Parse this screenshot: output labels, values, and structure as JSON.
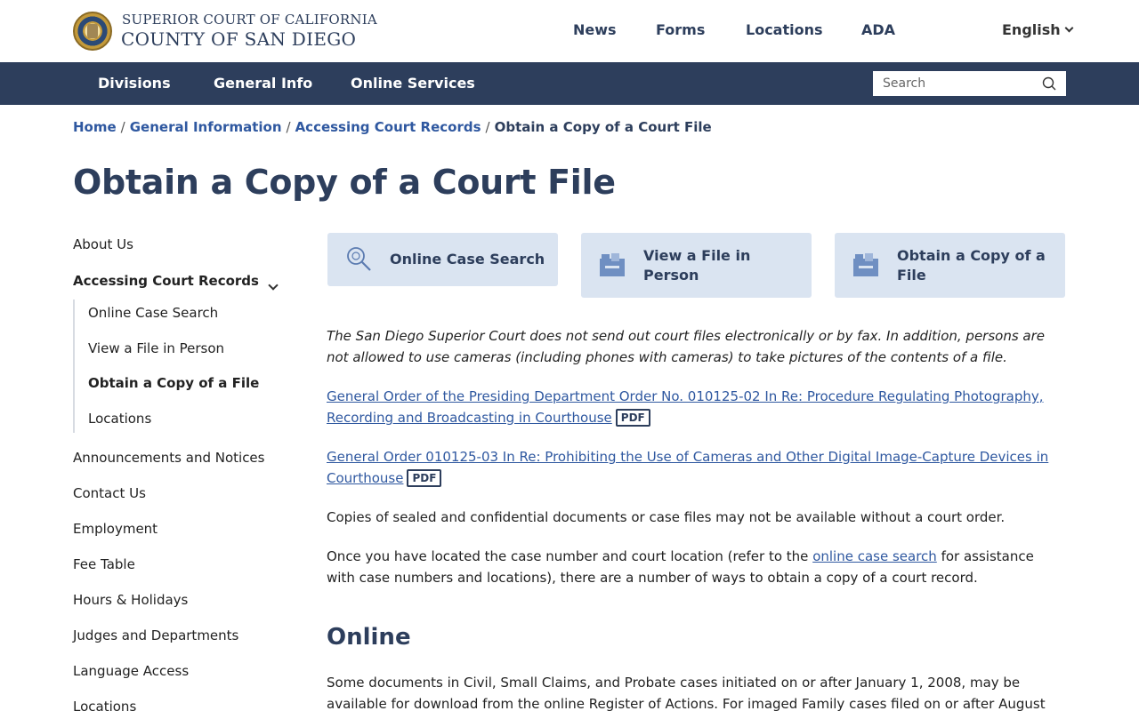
{
  "header": {
    "seal_icon": "court-seal-icon",
    "brand_top": "SUPERIOR COURT OF CALIFORNIA",
    "brand_main": "COUNTY OF SAN DIEGO",
    "links": [
      "News",
      "Forms",
      "Locations",
      "ADA"
    ],
    "language": "English"
  },
  "nav": {
    "items": [
      "Divisions",
      "General Info",
      "Online Services"
    ],
    "search_placeholder": "Search"
  },
  "breadcrumb": {
    "items": [
      "Home",
      "General Information",
      "Accessing Court Records"
    ],
    "separator": "/",
    "current": "Obtain a Copy of a Court File"
  },
  "page_title": "Obtain a Copy of a Court File",
  "sidebar": {
    "about": "About Us",
    "accessing": "Accessing Court Records",
    "sub_items": [
      "Online Case Search",
      "View a File in Person",
      "Obtain a Copy of a File",
      "Locations"
    ],
    "active_sub": "Obtain a Copy of a File",
    "items": [
      "Announcements and Notices",
      "Contact Us",
      "Employment",
      "Fee Table",
      "Hours & Holidays",
      "Judges and Departments",
      "Language Access",
      "Locations"
    ]
  },
  "cards": [
    {
      "label_1": "Online Case Search",
      "label_2": "",
      "icon": "magnifier-icon"
    },
    {
      "label_1": "View a File in",
      "label_2": "Person",
      "icon": "file-box-icon"
    },
    {
      "label_1": "Obtain a Copy of a",
      "label_2": "File",
      "icon": "file-box-icon"
    }
  ],
  "content": {
    "notice": "The San Diego Superior Court does not send out court files electronically or by fax. In addition, persons are not allowed to use cameras (including phones with cameras) to take pictures of the contents of a file.",
    "order1_link": "General Order of the Presiding Department Order No. 010125-02 In Re: Procedure Regulating Photography, Recording and Broadcasting in Courthouse",
    "order2_link": "General Order 010125-03 In Re: Prohibiting the Use of Cameras and Other Digital Image-Capture Devices in Courthouse",
    "pdf_badge": "PDF",
    "sealed": "Copies of sealed and confidential documents or case files may not be available without a court order.",
    "located_pre": "Once you have located the case number and court location (refer to the ",
    "located_link": "online case search",
    "located_post": " for assistance with case numbers and locations), there are a number of ways to obtain a copy of a court record.",
    "online_heading": "Online",
    "online_text": "Some documents in Civil, Small Claims, and Probate cases initiated on or after January 1, 2008, may be available for download from the online Register of Actions. For imaged Family cases filed on or after August"
  },
  "colors": {
    "navy": "#2d3e5c",
    "link": "#2f58a0",
    "card_bg": "#dae4f1"
  }
}
